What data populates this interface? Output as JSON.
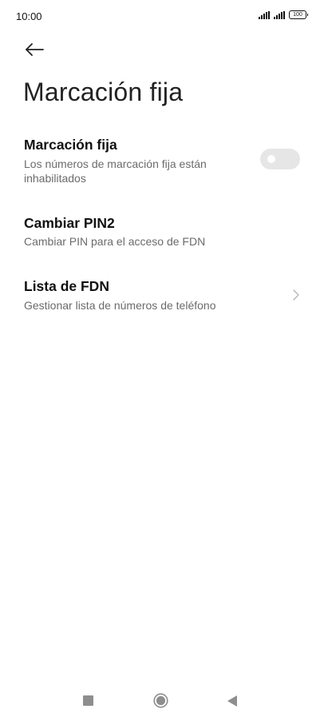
{
  "status_bar": {
    "time": "10:00",
    "battery": "100",
    "icons": [
      "signal-icon",
      "signal-icon",
      "battery-icon"
    ]
  },
  "header": {
    "back_icon": "arrow-left-icon",
    "title": "Marcación fija"
  },
  "settings": {
    "fixed_dialing": {
      "title": "Marcación fija",
      "subtitle_line1": "Los números de marcación fija están",
      "subtitle_line2": "inhabilitados",
      "toggle_state": "off"
    },
    "change_pin2": {
      "title": "Cambiar PIN2",
      "subtitle": "Cambiar PIN para el acceso de FDN"
    },
    "fdn_list": {
      "title": "Lista de FDN",
      "subtitle": "Gestionar lista de números de teléfono",
      "icon": "chevron-right-icon"
    }
  },
  "nav_bar": {
    "icons": [
      "recents-icon",
      "home-icon",
      "back-icon"
    ]
  }
}
